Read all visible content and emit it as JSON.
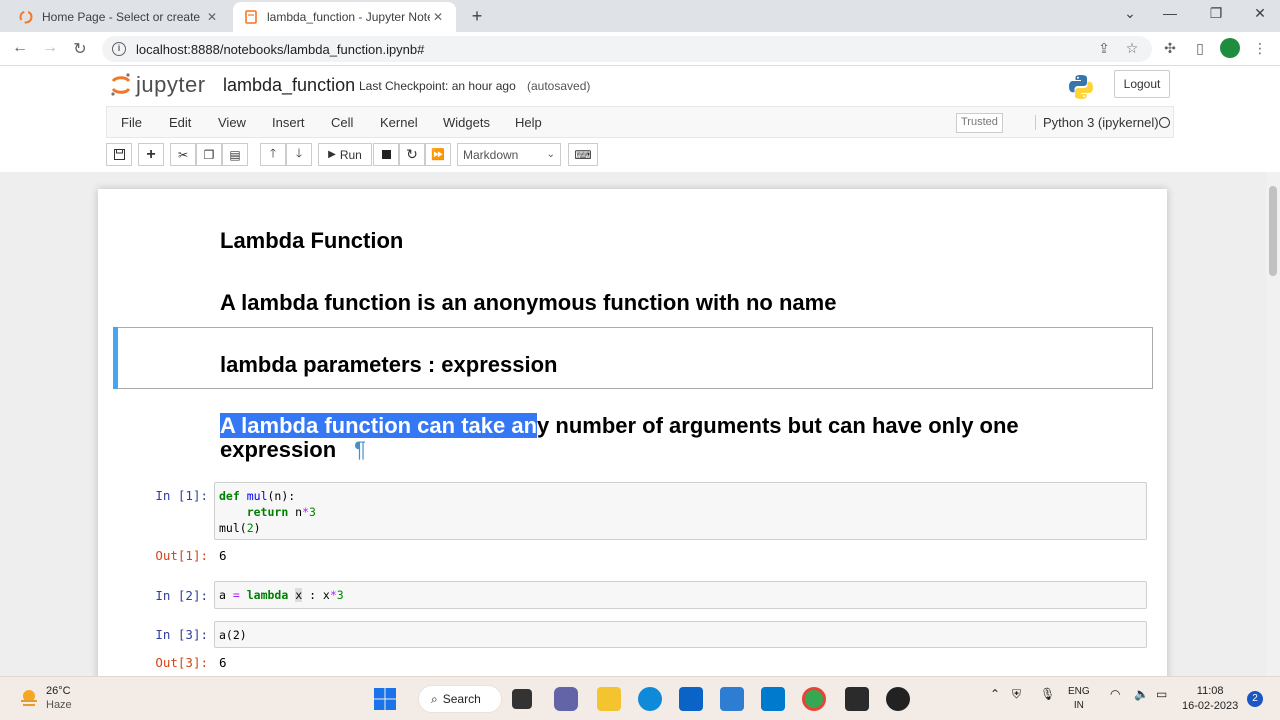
{
  "browser": {
    "tabs": [
      {
        "title": "Home Page - Select or create a n",
        "active": false
      },
      {
        "title": "lambda_function - Jupyter Noteb",
        "active": true
      }
    ],
    "url": "localhost:8888/notebooks/lambda_function.ipynb#"
  },
  "jupyter": {
    "logo_text": "jupyter",
    "notebook_name": "lambda_function",
    "checkpoint": "Last Checkpoint: an hour ago",
    "autosaved": "(autosaved)",
    "logout": "Logout",
    "menu": [
      "File",
      "Edit",
      "View",
      "Insert",
      "Cell",
      "Kernel",
      "Widgets",
      "Help"
    ],
    "trusted": "Trusted",
    "kernel": "Python 3 (ipykernel)",
    "toolbar": {
      "run_label": "Run",
      "cell_type": "Markdown"
    }
  },
  "cells": {
    "h1": "Lambda Function",
    "h2": "A lambda function is an anonymous function with no name",
    "h3": "lambda parameters : expression",
    "h4_selected": "A lambda function can take an",
    "h4_rest": "y number of arguments but can have only one",
    "h4_line2": "expression",
    "h4_pilcrow": "¶",
    "in1_prompt": "In [1]:",
    "out1_prompt": "Out[1]:",
    "out1": "6",
    "in2_prompt": "In [2]:",
    "in3_prompt": "In [3]:",
    "in3_code": "a(2)",
    "out3_prompt": "Out[3]:",
    "out3": "6"
  },
  "taskbar": {
    "temp": "26°C",
    "weather": "Haze",
    "search": "Search",
    "lang1": "ENG",
    "lang2": "IN",
    "time": "11:08",
    "date": "16-02-2023",
    "notifications": "2"
  }
}
